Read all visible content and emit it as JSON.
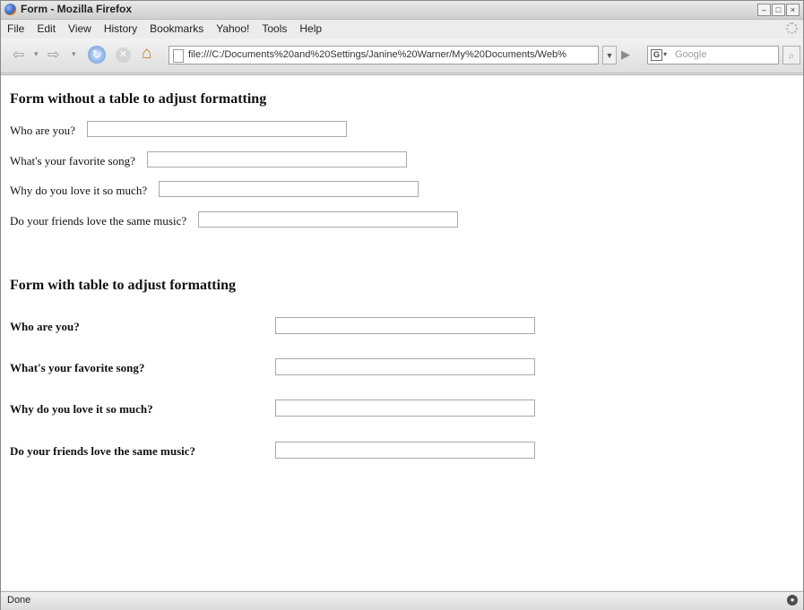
{
  "window": {
    "title": "Form - Mozilla Firefox",
    "controls": [
      "–",
      "□",
      "×"
    ]
  },
  "menubar": {
    "items": [
      "File",
      "Edit",
      "View",
      "History",
      "Bookmarks",
      "Yahoo!",
      "Tools",
      "Help"
    ]
  },
  "navbar": {
    "back_icon": "back-arrow-icon",
    "forward_icon": "forward-arrow-icon",
    "url": "file:///C:/Documents%20and%20Settings/Janine%20Warner/My%20Documents/Web%",
    "search_engine_icon": "G",
    "search_placeholder": "Google"
  },
  "page": {
    "section1": {
      "heading": "Form without a table to adjust formatting",
      "fields": [
        {
          "label": "Who are you?",
          "value": ""
        },
        {
          "label": "What's your favorite song?",
          "value": ""
        },
        {
          "label": "Why do you love it so much?",
          "value": ""
        },
        {
          "label": "Do your friends love the same music?",
          "value": ""
        }
      ]
    },
    "section2": {
      "heading": "Form with table to adjust formatting",
      "fields": [
        {
          "label": "Who are you?",
          "value": ""
        },
        {
          "label": "What's your favorite song?",
          "value": ""
        },
        {
          "label": "Why do you love it so much?",
          "value": ""
        },
        {
          "label": "Do your friends love the same music?",
          "value": ""
        }
      ]
    }
  },
  "statusbar": {
    "text": "Done"
  }
}
